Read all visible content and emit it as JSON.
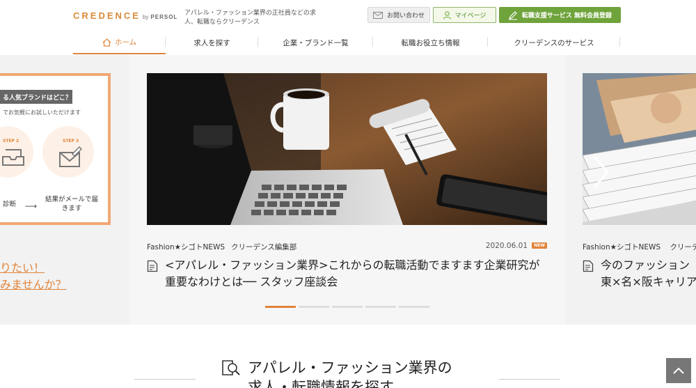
{
  "header": {
    "logo_main": "CREDENCE",
    "logo_by": "by",
    "logo_persol": "PERSOL",
    "tagline": "アパレル・ファッション業界の正社員などの求人、転職ならクリーデンス",
    "contact_label": "お問い合わせ",
    "mypage_label": "マイページ",
    "register_label": "転職支援サービス 無料会員登録"
  },
  "nav": {
    "items": [
      {
        "label": "ホーム",
        "active": true
      },
      {
        "label": "求人を探す"
      },
      {
        "label": "企業・ブランド一覧"
      },
      {
        "label": "転職お役立ち情報"
      },
      {
        "label": "クリーデンスのサービス"
      }
    ]
  },
  "left_promo": {
    "bar_text": "る人気ブランドはどこ？",
    "sub_text": "でお気軽にお試しいただけます",
    "step2": "STEP 2",
    "step3": "STEP 3",
    "cap_left": "診断",
    "cap_right": "結果がメールで届きます",
    "cta_line1": "りたい！",
    "cta_line2": "みませんか？"
  },
  "card": {
    "category": "Fashion★シゴトNEWS",
    "author": "クリーデンス編集部",
    "date": "2020.06.01",
    "badge": "NEW",
    "title": "<アパレル・ファッション業界>これからの転職活動でますます企業研究が重要なわけとは── スタッフ座談会"
  },
  "right_card": {
    "category": "Fashion★シゴトNEWS",
    "author": "クリーデ",
    "title_line1": "今のファッション",
    "title_line2": "東×名×阪キャリア"
  },
  "carousel": {
    "slide_count": 5,
    "active_index": 0
  },
  "section": {
    "heading_line1": "アパレル・ファッション業界の",
    "heading_line2": "求人・転職情報を探す"
  },
  "colors": {
    "accent": "#e0843a",
    "green": "#6fa33b",
    "band_bg": "#f2f2f2"
  }
}
